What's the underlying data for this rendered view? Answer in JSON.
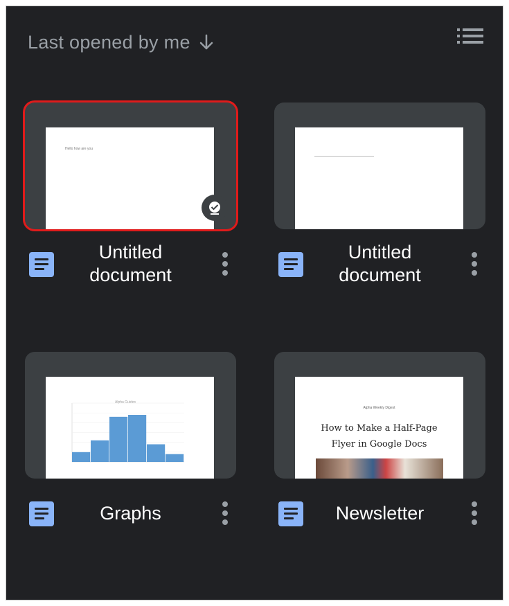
{
  "header": {
    "sort_label": "Last opened by me",
    "sort_icon": "arrow-down-icon",
    "view_toggle_icon": "list-view-icon"
  },
  "colors": {
    "background": "#202124",
    "thumbnail_bg": "#3c4043",
    "doc_icon": "#8ab4f8",
    "selected_outline": "#e01b1b",
    "title_text": "#ffffff",
    "muted_text": "#9aa0a6"
  },
  "files": [
    {
      "title_line1": "Untitled",
      "title_line2": "document",
      "preview_text": "Hello how are you",
      "selected": true,
      "offline": true
    },
    {
      "title_line1": "Untitled",
      "title_line2": "document",
      "selected": false
    },
    {
      "title": "Graphs",
      "preview_chart_title": "Alpha Guides",
      "selected": false
    },
    {
      "title": "Newsletter",
      "preview_masthead": "Alpha Weekly Digest",
      "preview_heading_line1": "How to Make a Half-Page",
      "preview_heading_line2": "Flyer in Google Docs",
      "selected": false
    }
  ],
  "chart_data": {
    "type": "bar",
    "title": "Alpha Guides",
    "values": [
      5,
      11,
      23,
      24,
      9,
      4
    ],
    "ylim": [
      0,
      30
    ]
  }
}
